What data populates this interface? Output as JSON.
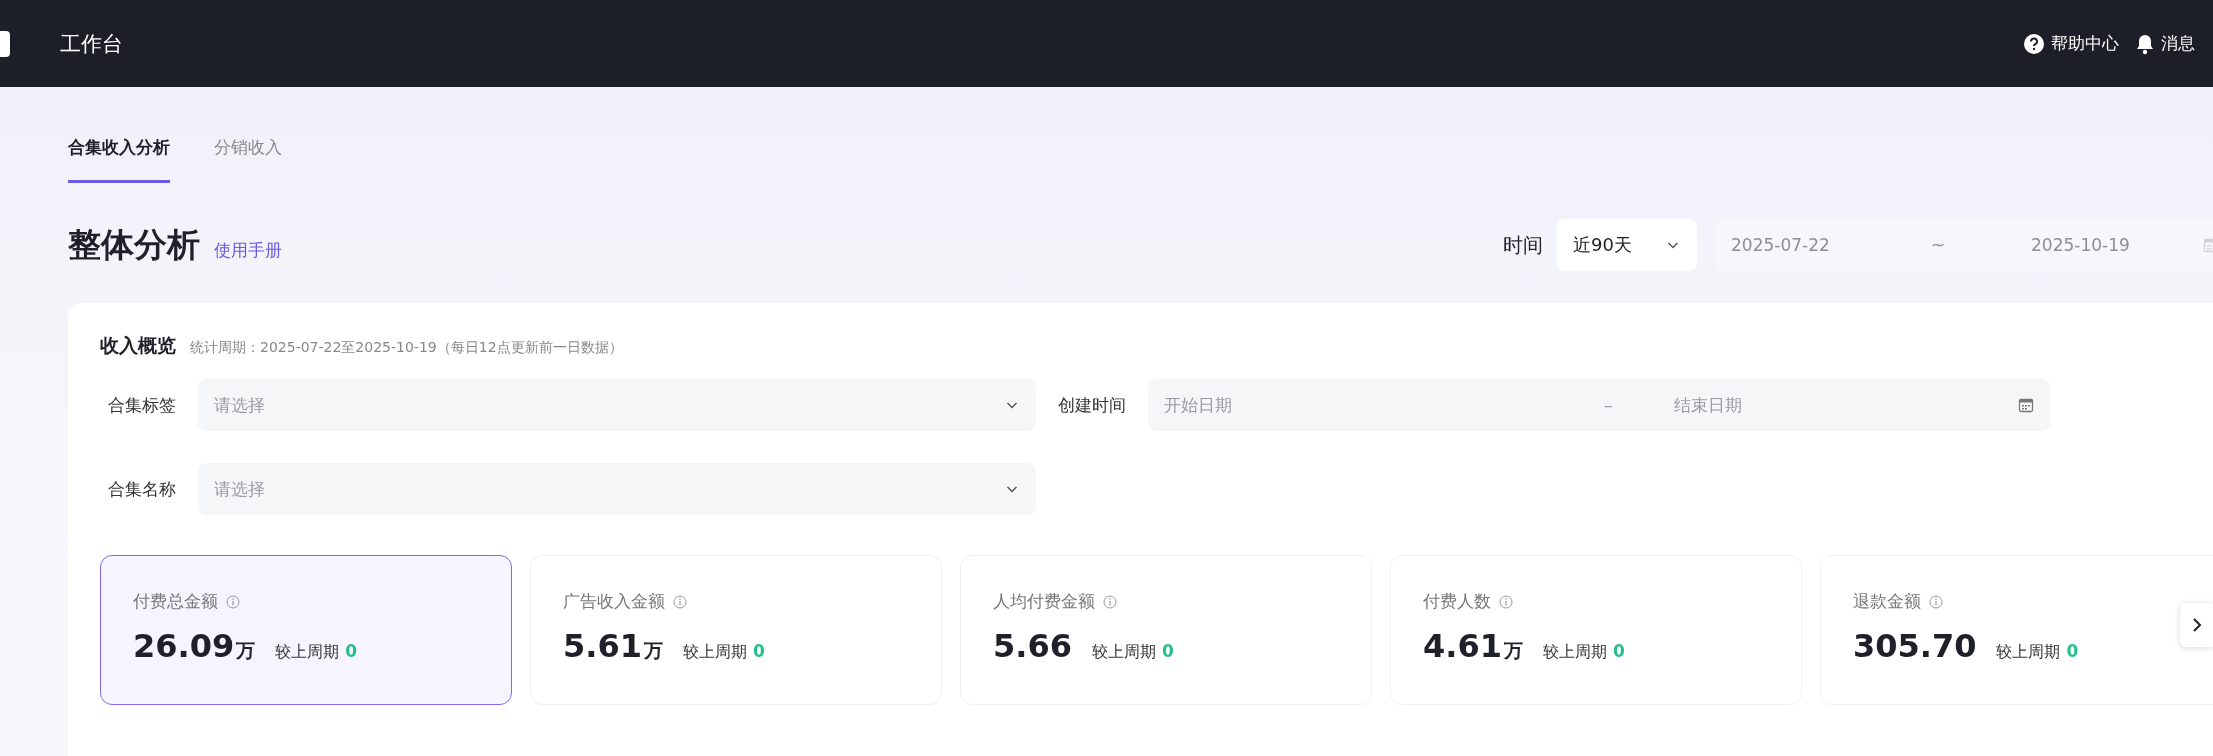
{
  "topbar": {
    "title": "工作台",
    "links": [
      {
        "kind": "help",
        "label": "帮助中心"
      },
      {
        "kind": "bell",
        "label": "消息"
      }
    ]
  },
  "tabs": [
    {
      "label": "合集收入分析",
      "selected": true
    },
    {
      "label": "分销收入",
      "selected": false
    }
  ],
  "header": {
    "title": "整体分析",
    "link": "使用手册",
    "time_label": "时间",
    "range_select": "近90天",
    "date_start": "2025-07-22",
    "date_separator": "~",
    "date_end": "2025-10-19"
  },
  "overview": {
    "title": "收入概览",
    "note": "统计周期：2025-07-22至2025-10-19（每日12点更新前一日数据）",
    "filters": [
      {
        "kind": "select",
        "label": "合集标签",
        "placeholder": "请选择"
      },
      {
        "kind": "daterange",
        "label": "创建时间",
        "start_placeholder": "开始日期",
        "separator": "–",
        "end_placeholder": "结束日期"
      },
      {
        "kind": "select",
        "label": "合集名称",
        "placeholder": "请选择"
      }
    ],
    "stats": [
      {
        "label": "付费总金额",
        "value": "26.09",
        "unit": "万",
        "compare_label": "较上周期",
        "change": "0",
        "selected": true
      },
      {
        "label": "广告收入金额",
        "value": "5.61",
        "unit": "万",
        "compare_label": "较上周期",
        "change": "0",
        "selected": false
      },
      {
        "label": "人均付费金额",
        "value": "5.66",
        "compare_label": "较上周期",
        "change": "0",
        "selected": false
      },
      {
        "label": "付费人数",
        "value": "4.61",
        "unit": "万",
        "compare_label": "较上周期",
        "change": "0",
        "selected": false
      },
      {
        "label": "退款金额",
        "value": "305.70",
        "compare_label": "较上周期",
        "change": "0",
        "selected": false
      }
    ]
  }
}
